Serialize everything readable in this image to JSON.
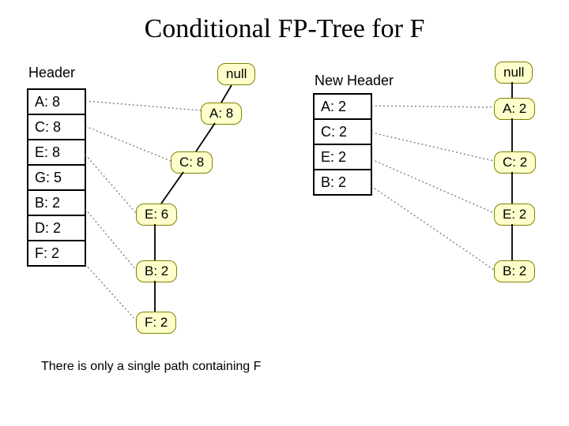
{
  "title": "Conditional FP-Tree for F",
  "left": {
    "header_label": "Header",
    "rows": [
      "A: 8",
      "C: 8",
      "E: 8",
      "G: 5",
      "B: 2",
      "D: 2",
      "F: 2"
    ],
    "nodes": {
      "null": "null",
      "a8": "A: 8",
      "c8": "C: 8",
      "e6": "E: 6",
      "b2": "B: 2",
      "f2": "F: 2"
    }
  },
  "right": {
    "header_label": "New Header",
    "rows": [
      "A: 2",
      "C: 2",
      "E: 2",
      "B: 2"
    ],
    "nodes": {
      "null": "null",
      "a2": "A: 2",
      "c2": "C: 2",
      "e2": "E: 2",
      "b2": "B: 2"
    }
  },
  "caption": "There is only a single path containing F"
}
